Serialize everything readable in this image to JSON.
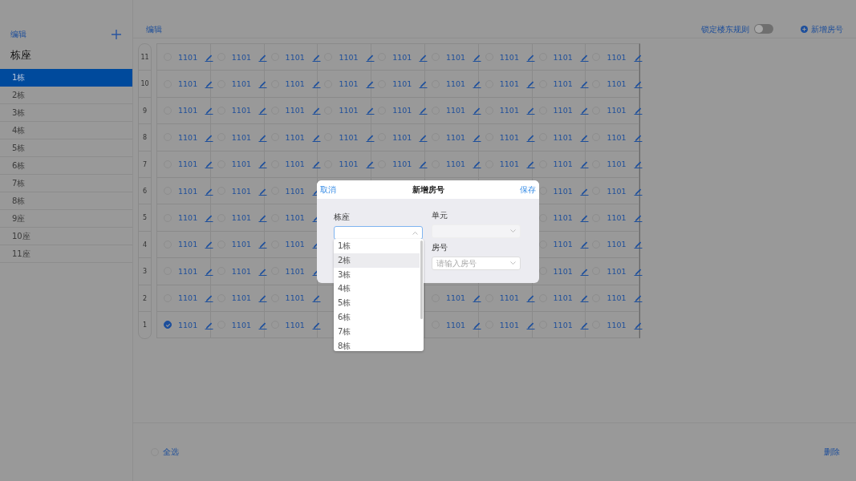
{
  "sidebar": {
    "edit_link": "编辑",
    "title": "栋座",
    "items": [
      {
        "label": "1栋",
        "selected": true
      },
      {
        "label": "2栋",
        "selected": false
      },
      {
        "label": "3栋",
        "selected": false
      },
      {
        "label": "4栋",
        "selected": false
      },
      {
        "label": "5栋",
        "selected": false
      },
      {
        "label": "6栋",
        "selected": false
      },
      {
        "label": "7栋",
        "selected": false
      },
      {
        "label": "8栋",
        "selected": false
      },
      {
        "label": "9座",
        "selected": false
      },
      {
        "label": "10座",
        "selected": false
      },
      {
        "label": "11座",
        "selected": false
      }
    ]
  },
  "toolbar": {
    "edit_link": "编辑",
    "lock_rule": {
      "label": "锁定楼东规则",
      "on": false
    },
    "add_button": "新增房号"
  },
  "grid": {
    "rows": [
      {
        "floor": "11",
        "cells": [
          {
            "kind": "room",
            "room": "1101",
            "checked": false
          },
          {
            "kind": "room",
            "room": "1101",
            "checked": false
          },
          {
            "kind": "room",
            "room": "1101",
            "checked": false
          },
          {
            "kind": "room",
            "room": "1101",
            "checked": false
          },
          {
            "kind": "room",
            "room": "1101",
            "checked": false
          },
          {
            "kind": "room",
            "room": "1101",
            "checked": false
          },
          {
            "kind": "room",
            "room": "1101",
            "checked": false
          },
          {
            "kind": "room",
            "room": "1101",
            "checked": false
          },
          {
            "kind": "room",
            "room": "1101",
            "checked": false
          }
        ]
      },
      {
        "floor": "10",
        "cells": [
          {
            "kind": "room",
            "room": "1101",
            "checked": false
          },
          {
            "kind": "room",
            "room": "1101",
            "checked": false
          },
          {
            "kind": "room",
            "room": "1101",
            "checked": false
          },
          {
            "kind": "room",
            "room": "1101",
            "checked": false
          },
          {
            "kind": "room",
            "room": "1101",
            "checked": false
          },
          {
            "kind": "room",
            "room": "1101",
            "checked": false
          },
          {
            "kind": "room",
            "room": "1101",
            "checked": false
          },
          {
            "kind": "room",
            "room": "1101",
            "checked": false
          },
          {
            "kind": "room",
            "room": "1101",
            "checked": false
          }
        ]
      },
      {
        "floor": "9",
        "cells": [
          {
            "kind": "room",
            "room": "1101",
            "checked": false
          },
          {
            "kind": "room",
            "room": "1101",
            "checked": false
          },
          {
            "kind": "room",
            "room": "1101",
            "checked": false
          },
          {
            "kind": "room",
            "room": "1101",
            "checked": false
          },
          {
            "kind": "room",
            "room": "1101",
            "checked": false
          },
          {
            "kind": "room",
            "room": "1101",
            "checked": false
          },
          {
            "kind": "room",
            "room": "1101",
            "checked": false
          },
          {
            "kind": "room",
            "room": "1101",
            "checked": false
          },
          {
            "kind": "room",
            "room": "1101",
            "checked": false
          }
        ]
      },
      {
        "floor": "8",
        "cells": [
          {
            "kind": "room",
            "room": "1101",
            "checked": false
          },
          {
            "kind": "room",
            "room": "1101",
            "checked": false
          },
          {
            "kind": "room",
            "room": "1101",
            "checked": false
          },
          {
            "kind": "room",
            "room": "1101",
            "checked": false
          },
          {
            "kind": "room",
            "room": "1101",
            "checked": false
          },
          {
            "kind": "room",
            "room": "1101",
            "checked": false
          },
          {
            "kind": "room",
            "room": "1101",
            "checked": false
          },
          {
            "kind": "room",
            "room": "1101",
            "checked": false
          },
          {
            "kind": "room",
            "room": "1101",
            "checked": false
          }
        ]
      },
      {
        "floor": "7",
        "cells": [
          {
            "kind": "room",
            "room": "1101",
            "checked": false
          },
          {
            "kind": "room",
            "room": "1101",
            "checked": false
          },
          {
            "kind": "room",
            "room": "1101",
            "checked": false
          },
          {
            "kind": "room",
            "room": "1101",
            "checked": false
          },
          {
            "kind": "room",
            "room": "1101",
            "checked": false
          },
          {
            "kind": "room",
            "room": "1101",
            "checked": false
          },
          {
            "kind": "room",
            "room": "1101",
            "checked": false
          },
          {
            "kind": "room",
            "room": "1101",
            "checked": false
          },
          {
            "kind": "room",
            "room": "1101",
            "checked": false
          }
        ]
      },
      {
        "floor": "6",
        "cells": [
          {
            "kind": "room",
            "room": "1101",
            "checked": false
          },
          {
            "kind": "room",
            "room": "1101",
            "checked": false
          },
          {
            "kind": "room",
            "room": "1101",
            "checked": false
          },
          {
            "kind": "covered"
          },
          {
            "kind": "covered"
          },
          {
            "kind": "covered"
          },
          {
            "kind": "covered"
          },
          {
            "kind": "room",
            "room": "1101",
            "checked": false
          },
          {
            "kind": "room",
            "room": "1101",
            "checked": false
          }
        ]
      },
      {
        "floor": "5",
        "cells": [
          {
            "kind": "room",
            "room": "1101",
            "checked": false
          },
          {
            "kind": "room",
            "room": "1101",
            "checked": false
          },
          {
            "kind": "room",
            "room": "1101",
            "checked": false
          },
          {
            "kind": "covered"
          },
          {
            "kind": "covered"
          },
          {
            "kind": "covered"
          },
          {
            "kind": "covered"
          },
          {
            "kind": "room",
            "room": "1101",
            "checked": false
          },
          {
            "kind": "room",
            "room": "1101",
            "checked": false
          }
        ]
      },
      {
        "floor": "4",
        "cells": [
          {
            "kind": "room",
            "room": "1101",
            "checked": false
          },
          {
            "kind": "room",
            "room": "1101",
            "checked": false
          },
          {
            "kind": "room",
            "room": "1101",
            "checked": false
          },
          {
            "kind": "covered"
          },
          {
            "kind": "covered"
          },
          {
            "kind": "covered"
          },
          {
            "kind": "covered"
          },
          {
            "kind": "room",
            "room": "1101",
            "checked": false
          },
          {
            "kind": "room",
            "room": "1101",
            "checked": false
          }
        ]
      },
      {
        "floor": "3",
        "cells": [
          {
            "kind": "room",
            "room": "1101",
            "checked": false
          },
          {
            "kind": "room",
            "room": "1101",
            "checked": false
          },
          {
            "kind": "room",
            "room": "1101",
            "checked": false
          },
          {
            "kind": "covered"
          },
          {
            "kind": "covered"
          },
          {
            "kind": "covered"
          },
          {
            "kind": "covered"
          },
          {
            "kind": "room",
            "room": "1101",
            "checked": false
          },
          {
            "kind": "room",
            "room": "1101",
            "checked": false
          }
        ]
      },
      {
        "floor": "2",
        "cells": [
          {
            "kind": "room",
            "room": "1101",
            "checked": false
          },
          {
            "kind": "room",
            "room": "1101",
            "checked": false
          },
          {
            "kind": "room",
            "room": "1101",
            "checked": false
          },
          {
            "kind": "covered"
          },
          {
            "kind": "covered"
          },
          {
            "kind": "room",
            "room": "1101",
            "checked": false
          },
          {
            "kind": "room",
            "room": "1101",
            "checked": false
          },
          {
            "kind": "room",
            "room": "1101",
            "checked": false
          },
          {
            "kind": "room",
            "room": "1101",
            "checked": false
          }
        ]
      },
      {
        "floor": "1",
        "cells": [
          {
            "kind": "room",
            "room": "1101",
            "checked": true
          },
          {
            "kind": "room",
            "room": "1101",
            "checked": false
          },
          {
            "kind": "room",
            "room": "1101",
            "checked": false
          },
          {
            "kind": "covered"
          },
          {
            "kind": "covered"
          },
          {
            "kind": "room",
            "room": "1101",
            "checked": false
          },
          {
            "kind": "room",
            "room": "1101",
            "checked": false
          },
          {
            "kind": "room",
            "room": "1101",
            "checked": false
          },
          {
            "kind": "room",
            "room": "1101",
            "checked": false
          }
        ]
      }
    ]
  },
  "footer": {
    "select_all": {
      "label": "全选",
      "checked": false
    },
    "delete_button": "删除"
  },
  "dialog": {
    "cancel": "取消",
    "title": "新增房号",
    "save": "保存",
    "fields": [
      {
        "label": "栋座",
        "open": true,
        "disabled": false
      },
      {
        "label": "单元",
        "open": false,
        "disabled": true
      },
      {
        "label": "房号",
        "open": false,
        "disabled": false,
        "placeholder": "请输入房号"
      }
    ],
    "dropdown": [
      {
        "label": "1栋",
        "highlighted": false
      },
      {
        "label": "2栋",
        "highlighted": true
      },
      {
        "label": "3栋",
        "highlighted": false
      },
      {
        "label": "4栋",
        "highlighted": false
      },
      {
        "label": "5栋",
        "highlighted": false
      },
      {
        "label": "6栋",
        "highlighted": false
      },
      {
        "label": "7栋",
        "highlighted": false
      },
      {
        "label": "8栋",
        "highlighted": false
      }
    ]
  }
}
